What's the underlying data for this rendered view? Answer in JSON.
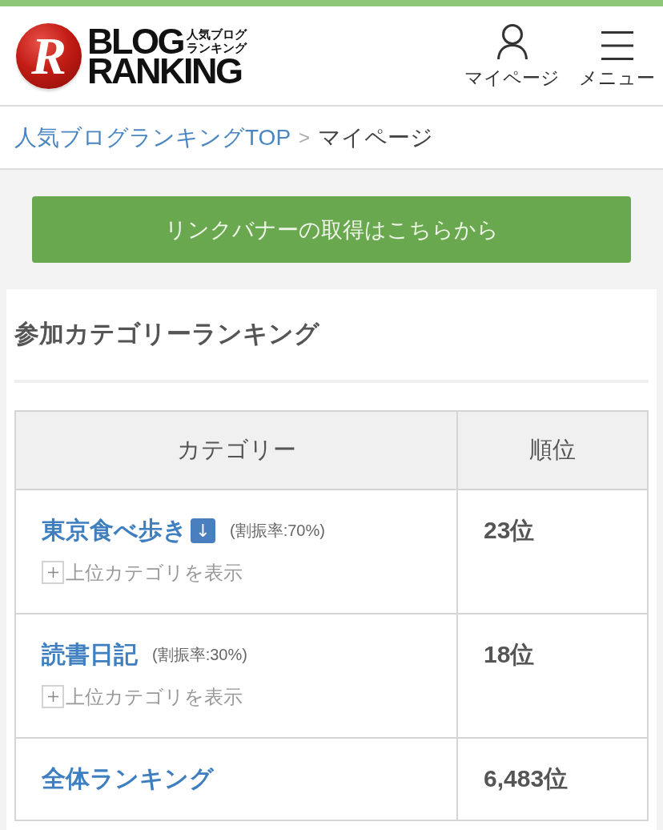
{
  "header": {
    "logo": {
      "emblem": "R",
      "title_lines": [
        "BLOG",
        "RANKING"
      ],
      "subtitle_lines": [
        "人気ブログ",
        "ランキング"
      ]
    },
    "nav": [
      {
        "kind": "person",
        "label": "マイページ"
      },
      {
        "kind": "menu",
        "label": "メニュー"
      }
    ]
  },
  "breadcrumb": {
    "items": [
      {
        "label": "人気ブログランキングTOP",
        "current": false
      },
      {
        "label": "マイページ",
        "current": true
      }
    ],
    "separator": ">"
  },
  "banner_button": {
    "label": "リンクバナーの取得はこちらから"
  },
  "ranking_panel": {
    "title": "参加カテゴリーランキング",
    "table": {
      "columns": [
        "カテゴリー",
        "順位"
      ],
      "rows": [
        {
          "category": "東京食べ歩き",
          "trend": "↓",
          "share": "(割振率:70%)",
          "toggle": {
            "label": "上位カテゴリを表示",
            "expanded": false
          },
          "rank": "23位"
        },
        {
          "category": "読書日記",
          "share": "(割振率:30%)",
          "toggle": {
            "label": "上位カテゴリを表示",
            "expanded": false
          },
          "rank": "18位"
        },
        {
          "category": "全体ランキング",
          "rank": "6,483位"
        }
      ]
    }
  }
}
